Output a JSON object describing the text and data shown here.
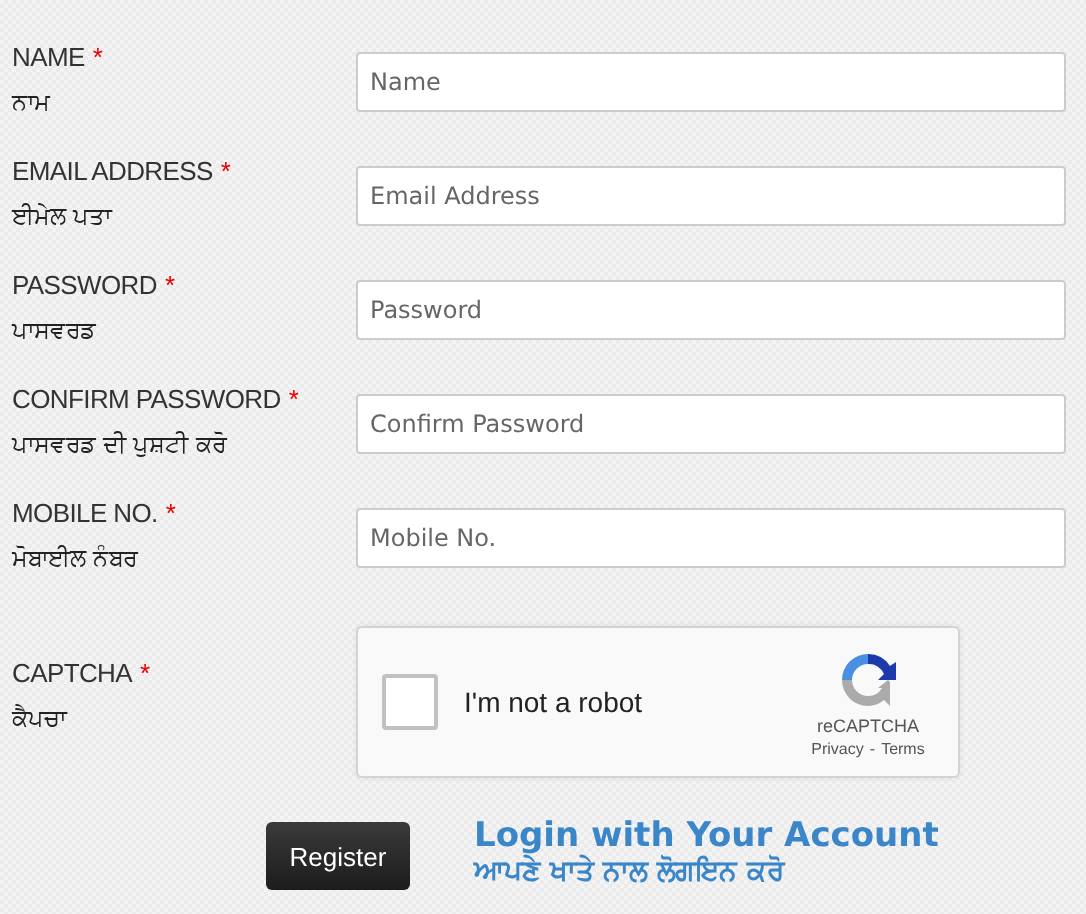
{
  "fields": [
    {
      "label": "NAME",
      "required_mark": "*",
      "label_pa": "ਨਾਮ",
      "placeholder": "Name"
    },
    {
      "label": "EMAIL ADDRESS",
      "required_mark": "*",
      "label_pa": "ਈਮੇਲ ਪਤਾ",
      "placeholder": "Email Address"
    },
    {
      "label": "PASSWORD",
      "required_mark": "*",
      "label_pa": "ਪਾਸਵਰਡ",
      "placeholder": "Password"
    },
    {
      "label": "CONFIRM PASSWORD",
      "required_mark": "*",
      "label_pa": "ਪਾਸਵਰਡ ਦੀ ਪੁਸ਼ਟੀ ਕਰੋ",
      "placeholder": "Confirm Password"
    },
    {
      "label": "MOBILE NO.",
      "required_mark": "*",
      "label_pa": "ਮੋਬਾਈਲ ਨੰਬਰ",
      "placeholder": "Mobile No."
    }
  ],
  "captcha": {
    "label": "CAPTCHA",
    "required_mark": "*",
    "label_pa": "ਕੈਪਚਾ",
    "checkbox_text": "I'm not a robot",
    "checked": false,
    "brand": "reCAPTCHA",
    "privacy": "Privacy",
    "separator": "-",
    "terms": "Terms"
  },
  "register_button": "Register",
  "login_link": {
    "title": "Login with Your Account",
    "title_pa": "ਆਪਣੇ ਖਾਤੇ ਨਾਲ ਲੋਗਇਨ ਕਰੋ"
  }
}
